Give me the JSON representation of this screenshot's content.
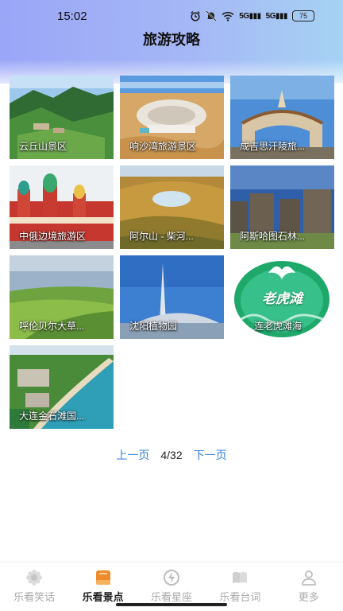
{
  "status_bar": {
    "time": "15:02",
    "signal_1": "5G",
    "signal_2": "5G",
    "battery": "75",
    "icons": [
      "alarm-icon",
      "mute-icon",
      "wifi-icon",
      "signal-icon",
      "signal-icon",
      "battery-icon"
    ]
  },
  "header": {
    "title": "旅游攻略"
  },
  "cards": [
    {
      "label": "云丘山景区",
      "theme": "green-mountain"
    },
    {
      "label": "响沙湾旅游景区",
      "theme": "desert-resort"
    },
    {
      "label": "成吉思汗陵旅...",
      "theme": "gate-monument"
    },
    {
      "label": "中俄边境旅游区",
      "theme": "russian-castle"
    },
    {
      "label": "阿尔山 - 柴河...",
      "theme": "crater-lake"
    },
    {
      "label": "阿斯哈图石林...",
      "theme": "stone-forest"
    },
    {
      "label": "呼伦贝尔大草...",
      "theme": "grassland"
    },
    {
      "label": "沈阳植物园",
      "theme": "tower-building"
    },
    {
      "label": "连老虎滩海",
      "theme": "whale-logo",
      "logo_text": "老虎滩"
    },
    {
      "label": "大连金石滩国...",
      "theme": "coast-aerial"
    }
  ],
  "pager": {
    "prev": "上一页",
    "current": "4/32",
    "next": "下一页"
  },
  "tabbar": [
    {
      "label": "乐看笑话",
      "icon": "flower-icon",
      "active": false
    },
    {
      "label": "乐看景点",
      "icon": "book-icon",
      "active": true
    },
    {
      "label": "乐看星座",
      "icon": "lightning-icon",
      "active": false
    },
    {
      "label": "乐看台词",
      "icon": "open-book-icon",
      "active": false
    },
    {
      "label": "更多",
      "icon": "user-icon",
      "active": false
    }
  ],
  "colors": {
    "accent": "#2f7fd8",
    "header_start": "#9aa6f7",
    "header_end": "#a6d2f3",
    "tab_active": "#e98a2f"
  }
}
